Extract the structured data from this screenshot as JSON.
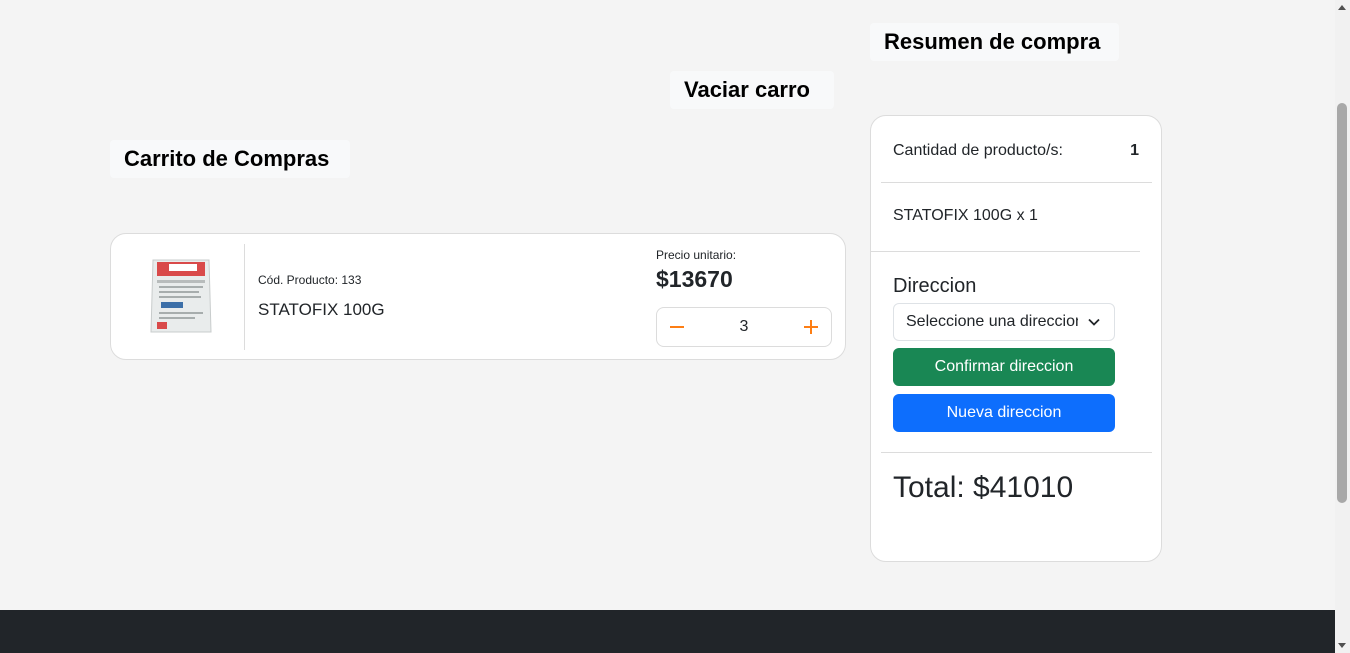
{
  "summary_title": "Resumen de compra",
  "empty_cart_label": "Vaciar carro",
  "cart_title": "Carrito de Compras",
  "product": {
    "image_icon": "product-bag-image",
    "code_label": "Cód. Producto: 133",
    "name": "STATOFIX 100G",
    "price_label": "Precio unitario:",
    "price": "$13670",
    "quantity": "3",
    "minus_icon": "minus-icon",
    "plus_icon": "plus-icon"
  },
  "summary": {
    "qty_label": "Cantidad de producto/s:",
    "qty_value": "1",
    "item_line": "STATOFIX 100G x 1",
    "address_label": "Direccion",
    "address_select_value": "Seleccione una direccion",
    "confirm_button": "Confirmar direccion",
    "new_address_button": "Nueva direccion",
    "total": "Total: $41010"
  },
  "colors": {
    "accent_orange": "#fd7e14",
    "confirm_green": "#198754",
    "new_blue": "#0d6efd",
    "footer": "#212529"
  }
}
